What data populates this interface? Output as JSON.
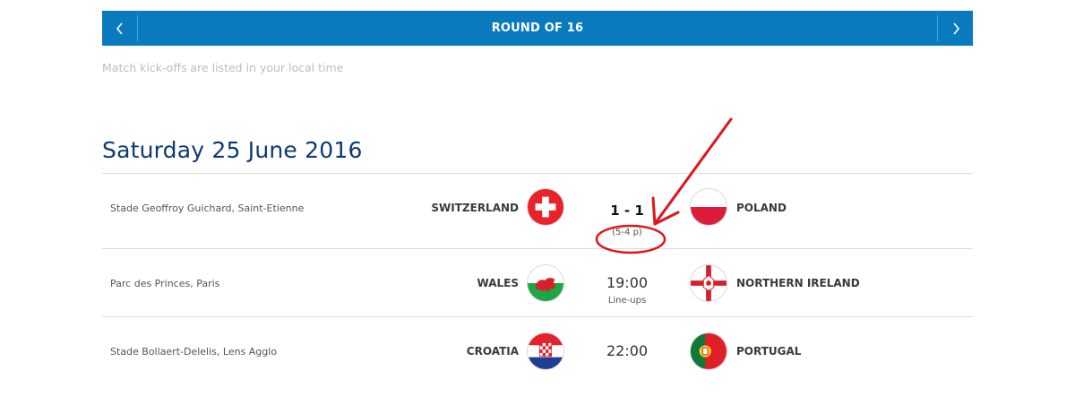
{
  "round": {
    "title": "ROUND OF 16"
  },
  "note": "Match kick-offs are listed in your local time",
  "date_heading": "Saturday 25 June 2016",
  "matches": [
    {
      "stadium": "Stade Geoffroy Guichard, Saint-Etienne",
      "home": "SWITZERLAND",
      "away": "POLAND",
      "score": "1 - 1",
      "penalties": "(5-4 p)"
    },
    {
      "stadium": "Parc des Princes, Paris",
      "home": "WALES",
      "away": "NORTHERN IRELAND",
      "time": "19:00",
      "lineups": "Line-ups"
    },
    {
      "stadium": "Stade Bollaert-Delelis, Lens Agglo",
      "home": "CROATIA",
      "away": "PORTUGAL",
      "time": "22:00"
    }
  ],
  "colors": {
    "accent": "#0a7abf",
    "heading": "#0d3a70",
    "annotation": "#e0141c"
  },
  "icons": {
    "prev": "chevron-left-icon",
    "next": "chevron-right-icon"
  }
}
